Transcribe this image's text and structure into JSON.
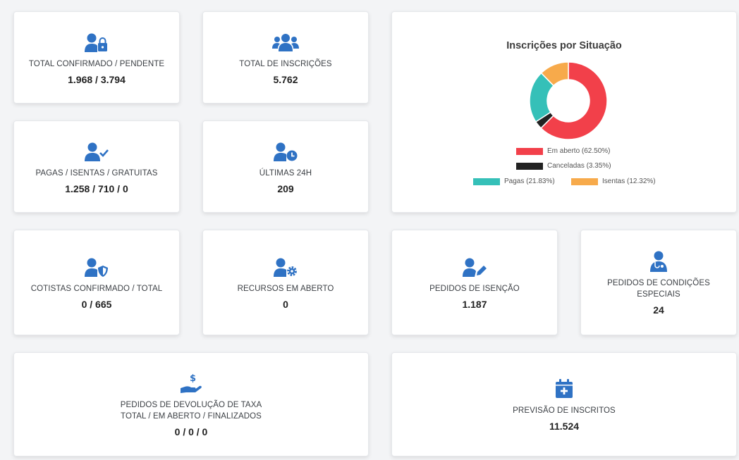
{
  "theme": {
    "accent": "#2f72c4"
  },
  "cards": {
    "total_confirmado": {
      "icon": "user-lock-icon",
      "label": "TOTAL CONFIRMADO / PENDENTE",
      "value": "1.968 / 3.794"
    },
    "total_inscricoes": {
      "icon": "users-icon",
      "label": "TOTAL DE INSCRIÇÕES",
      "value": "5.762"
    },
    "pagas": {
      "icon": "user-check-icon",
      "label": "PAGAS / ISENTAS / GRATUITAS",
      "value": "1.258 / 710 / 0"
    },
    "ultimas": {
      "icon": "user-clock-icon",
      "label": "ÚLTIMAS 24H",
      "value": "209"
    },
    "cotistas": {
      "icon": "user-shield-icon",
      "label": "COTISTAS CONFIRMADO / TOTAL",
      "value": "0 / 665"
    },
    "recursos": {
      "icon": "user-cog-icon",
      "label": "RECURSOS EM ABERTO",
      "value": "0"
    },
    "isencao": {
      "icon": "user-edit-icon",
      "label": "PEDIDOS DE ISENÇÃO",
      "value": "1.187"
    },
    "condicoes": {
      "icon": "user-doctor-icon",
      "label_line1": "PEDIDOS DE CONDIÇÕES",
      "label_line2": "ESPECIAIS",
      "value": "24"
    },
    "devolucao": {
      "icon": "hand-dollar-icon",
      "label_line1": "PEDIDOS DE DEVOLUÇÃO DE TAXA",
      "label_line2": "TOTAL / EM ABERTO / FINALIZADOS",
      "value": "0 / 0 / 0"
    },
    "previsao": {
      "icon": "calendar-plus-icon",
      "label": "PREVISÃO DE INSCRITOS",
      "value": "11.524"
    }
  },
  "chart_data": {
    "type": "pie",
    "title": "Inscrições por Situação",
    "donut": true,
    "legend": "bottom",
    "categories": [
      "Em aberto (62.50%)",
      "Canceladas (3.35%)",
      "Pagas (21.83%)",
      "Isentas (12.32%)"
    ],
    "values": [
      62.5,
      3.35,
      21.83,
      12.32
    ],
    "colors": [
      "#f2404a",
      "#222222",
      "#35c0b8",
      "#f7aa4b"
    ]
  }
}
